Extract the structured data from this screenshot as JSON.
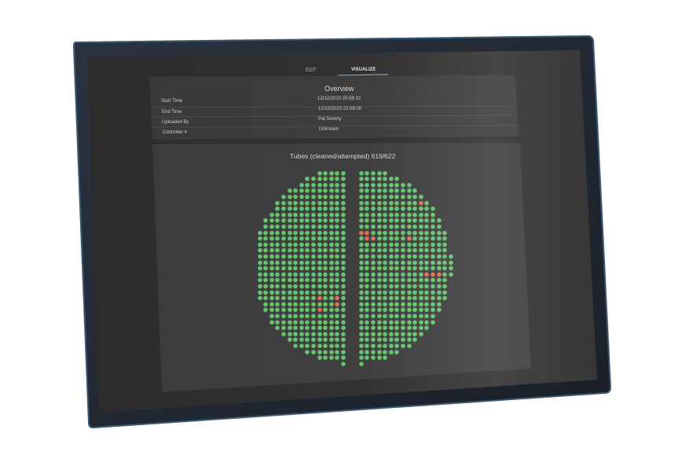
{
  "tabs": [
    {
      "label": "EDIT",
      "active": false
    },
    {
      "label": "VISUALIZE",
      "active": true
    }
  ],
  "overview": {
    "title": "Overview",
    "rows": [
      {
        "label": "Start Time",
        "value": "12/12/2020 20:58:32"
      },
      {
        "label": "End Time",
        "value": "12/12/2020 23:08:09"
      },
      {
        "label": "Uploaded By",
        "value": "Pat Severy"
      },
      {
        "label": "Controller #",
        "value": "Unknown"
      }
    ]
  },
  "tubes": {
    "title": "Tubes (cleaned/attempted) 619/622",
    "cleaned": 619,
    "attempted": 622
  },
  "colors": {
    "cleaned": "#63c36b",
    "failed": "#e26a4c",
    "panel": "#3a3a3a",
    "background": "#2b2b2b",
    "text": "#d8d8d8"
  }
}
